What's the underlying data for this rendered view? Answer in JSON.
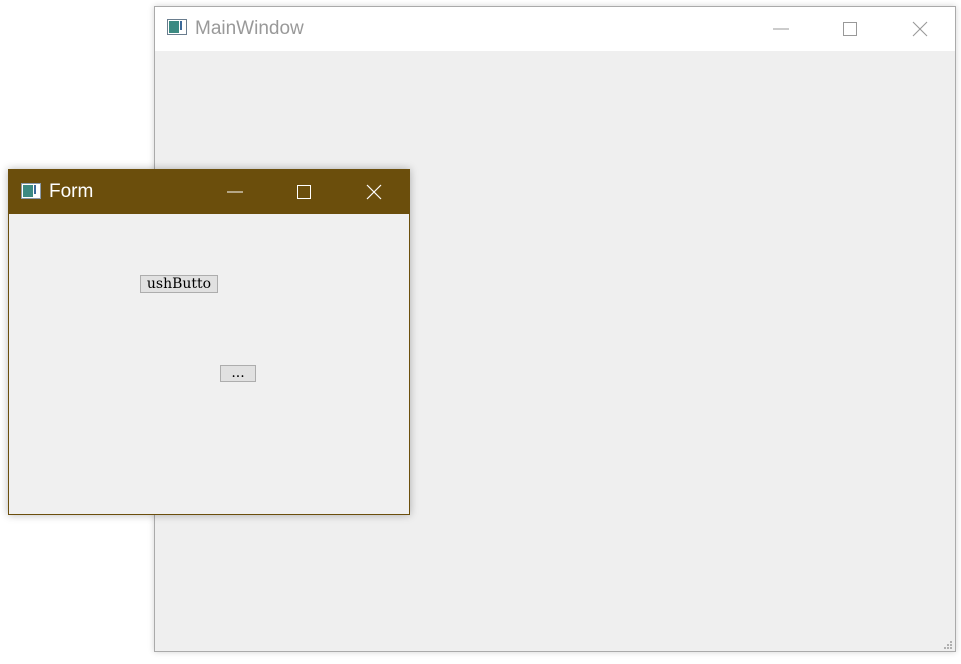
{
  "main_window": {
    "title": "MainWindow"
  },
  "form_window": {
    "title": "Form",
    "push_button_label": "ushButto",
    "tool_button_label": "..."
  },
  "colors": {
    "form_titlebar": "#6b4e0c",
    "main_titlebar": "#ffffff",
    "client_background": "#efefef",
    "main_title_text": "#999999"
  },
  "icons": {
    "app_icon": "qt-window-icon",
    "minimize": "minimize-icon",
    "maximize": "maximize-icon",
    "close": "close-icon",
    "resize_grip": "resize-grip-icon"
  }
}
